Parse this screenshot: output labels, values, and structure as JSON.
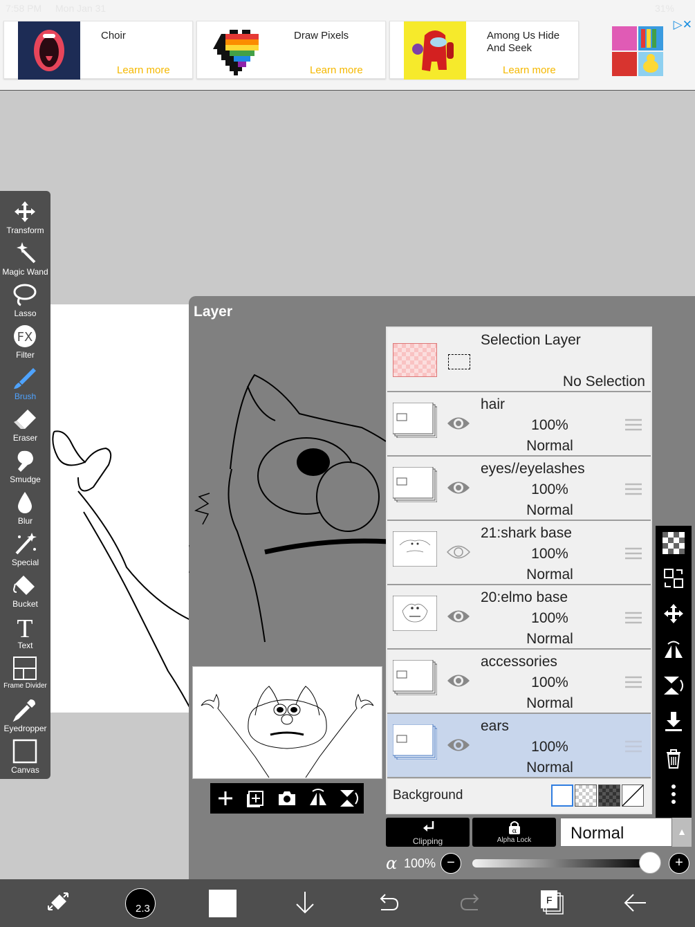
{
  "status_bar": {
    "time": "7:58 PM",
    "date": "Mon Jan 31",
    "battery": "31%"
  },
  "ads": [
    {
      "name": "Choir",
      "cta": "Learn more",
      "icon": "choir-app-icon"
    },
    {
      "name": "Draw Pixels",
      "cta": "Learn more",
      "icon": "pixel-heart-icon"
    },
    {
      "name": "Among Us Hide And Seek",
      "cta": "Learn more",
      "icon": "among-us-icon"
    }
  ],
  "tools": [
    {
      "label": "Transform",
      "icon": "transform-icon"
    },
    {
      "label": "Magic Wand",
      "icon": "magic-wand-icon"
    },
    {
      "label": "Lasso",
      "icon": "lasso-icon"
    },
    {
      "label": "Filter",
      "icon": "fx-icon"
    },
    {
      "label": "Brush",
      "icon": "brush-icon",
      "active": true
    },
    {
      "label": "Eraser",
      "icon": "eraser-icon"
    },
    {
      "label": "Smudge",
      "icon": "smudge-icon"
    },
    {
      "label": "Blur",
      "icon": "blur-icon"
    },
    {
      "label": "Special",
      "icon": "special-icon"
    },
    {
      "label": "Bucket",
      "icon": "bucket-icon"
    },
    {
      "label": "Text",
      "icon": "text-icon"
    },
    {
      "label": "Frame Divider",
      "icon": "frame-divider-icon"
    },
    {
      "label": "Eyedropper",
      "icon": "eyedropper-icon"
    },
    {
      "label": "Canvas",
      "icon": "canvas-icon"
    }
  ],
  "layer_panel": {
    "title": "Layer",
    "selection_layer": {
      "name": "Selection Layer",
      "status": "No Selection"
    },
    "layers": [
      {
        "name": "hair",
        "opacity": "100%",
        "blend": "Normal",
        "visible": true
      },
      {
        "name": "eyes//eyelashes",
        "opacity": "100%",
        "blend": "Normal",
        "visible": true
      },
      {
        "name": "21:shark base",
        "opacity": "100%",
        "blend": "Normal",
        "visible": false
      },
      {
        "name": "20:elmo base",
        "opacity": "100%",
        "blend": "Normal",
        "visible": true
      },
      {
        "name": "accessories",
        "opacity": "100%",
        "blend": "Normal",
        "visible": true
      },
      {
        "name": "ears",
        "opacity": "100%",
        "blend": "Normal",
        "visible": true,
        "selected": true
      }
    ],
    "background_label": "Background",
    "clipping_label": "Clipping",
    "alpha_lock_label": "Alpha Lock",
    "blend_mode": "Normal",
    "alpha_symbol": "α",
    "opacity": "100%"
  },
  "bottom_bar": {
    "brush_size": "2.3",
    "page_label": "F"
  },
  "colors": {
    "toolbar_bg": "#4e4e4e",
    "active_tool": "#4ea3ff",
    "selected_layer": "#c8d6ec",
    "ad_cta": "#f5b800",
    "panel_bg": "#808080"
  }
}
